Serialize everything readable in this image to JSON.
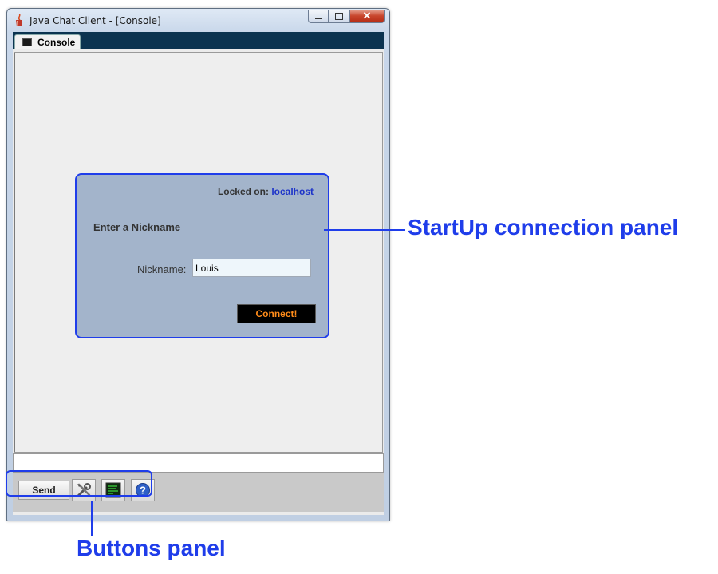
{
  "window": {
    "title": "Java Chat Client - [Console]",
    "controls": {
      "minimize": "minimize",
      "maximize": "maximize",
      "close": "close"
    }
  },
  "tabs": [
    {
      "label": "Console",
      "icon": "console-icon",
      "selected": true
    }
  ],
  "startup_panel": {
    "locked_label": "Locked on:",
    "locked_host": "localhost",
    "heading": "Enter a Nickname",
    "nickname_label": "Nickname:",
    "nickname_value": "Louis",
    "connect_label": "Connect!"
  },
  "message_input": {
    "value": ""
  },
  "buttons_panel": {
    "send_label": "Send",
    "tools_icon": "tools-icon",
    "console_icon": "terminal-icon",
    "help_icon": "help-icon"
  },
  "annotations": {
    "startup": "StartUp connection panel",
    "buttons": "Buttons panel"
  },
  "colors": {
    "annotation": "#1f3dea",
    "tabstrip": "#0b3350",
    "panel_bg": "#a3b4cb",
    "connect_text": "#ff8c1a",
    "host_link": "#1d33c9"
  }
}
